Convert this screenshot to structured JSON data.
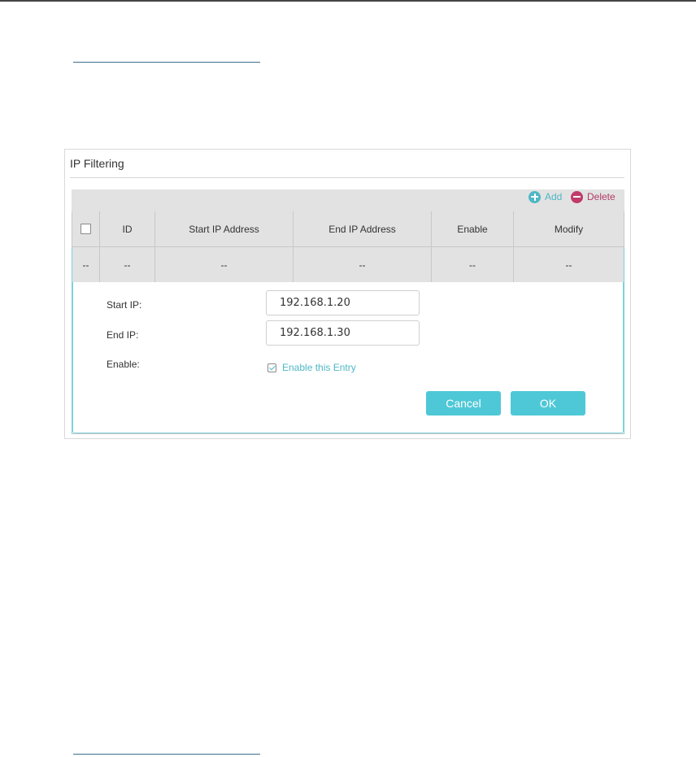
{
  "panel": {
    "title": "IP Filtering"
  },
  "toolbar": {
    "add_label": "Add",
    "delete_label": "Delete"
  },
  "table": {
    "columns": [
      "ID",
      "Start IP Address",
      "End IP Address",
      "Enable",
      "Modify"
    ],
    "row": [
      "--",
      "--",
      "--",
      "--",
      "--",
      "--"
    ]
  },
  "form": {
    "start_ip_label": "Start IP:",
    "start_ip_value": "192.168.1.20",
    "end_ip_label": "End IP:",
    "end_ip_value": "192.168.1.30",
    "enable_label": "Enable:",
    "enable_checkbox_label": "Enable this Entry",
    "enable_checked": true,
    "cancel_label": "Cancel",
    "ok_label": "OK"
  },
  "colors": {
    "accent": "#4ec8d6",
    "delete": "#c03a6c",
    "header_bg": "#e2e2e2"
  },
  "icons": {
    "add": "plus-circle-icon",
    "delete": "minus-circle-icon"
  }
}
